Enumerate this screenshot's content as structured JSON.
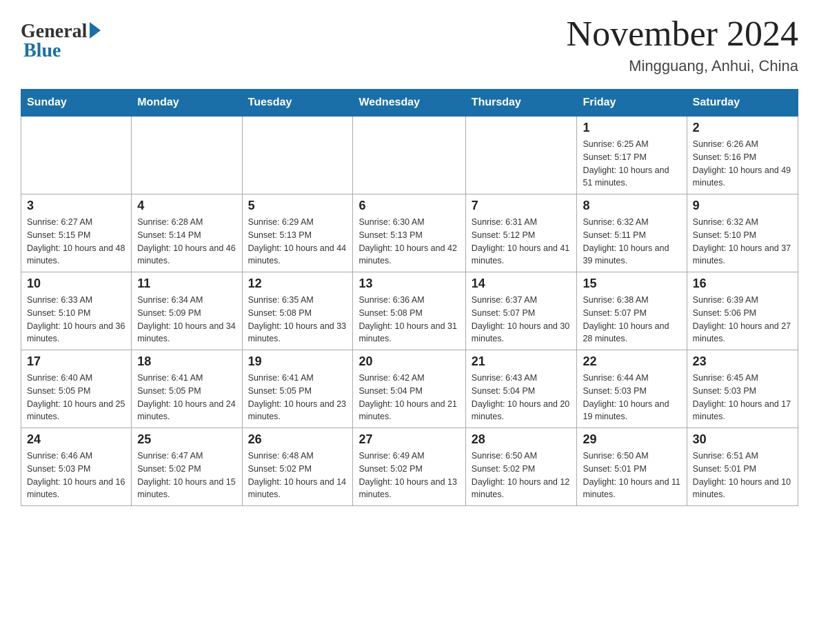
{
  "logo": {
    "general": "General",
    "blue": "Blue"
  },
  "header": {
    "month_year": "November 2024",
    "location": "Mingguang, Anhui, China"
  },
  "days_of_week": [
    "Sunday",
    "Monday",
    "Tuesday",
    "Wednesday",
    "Thursday",
    "Friday",
    "Saturday"
  ],
  "weeks": [
    [
      {
        "day": "",
        "info": ""
      },
      {
        "day": "",
        "info": ""
      },
      {
        "day": "",
        "info": ""
      },
      {
        "day": "",
        "info": ""
      },
      {
        "day": "",
        "info": ""
      },
      {
        "day": "1",
        "info": "Sunrise: 6:25 AM\nSunset: 5:17 PM\nDaylight: 10 hours and 51 minutes."
      },
      {
        "day": "2",
        "info": "Sunrise: 6:26 AM\nSunset: 5:16 PM\nDaylight: 10 hours and 49 minutes."
      }
    ],
    [
      {
        "day": "3",
        "info": "Sunrise: 6:27 AM\nSunset: 5:15 PM\nDaylight: 10 hours and 48 minutes."
      },
      {
        "day": "4",
        "info": "Sunrise: 6:28 AM\nSunset: 5:14 PM\nDaylight: 10 hours and 46 minutes."
      },
      {
        "day": "5",
        "info": "Sunrise: 6:29 AM\nSunset: 5:13 PM\nDaylight: 10 hours and 44 minutes."
      },
      {
        "day": "6",
        "info": "Sunrise: 6:30 AM\nSunset: 5:13 PM\nDaylight: 10 hours and 42 minutes."
      },
      {
        "day": "7",
        "info": "Sunrise: 6:31 AM\nSunset: 5:12 PM\nDaylight: 10 hours and 41 minutes."
      },
      {
        "day": "8",
        "info": "Sunrise: 6:32 AM\nSunset: 5:11 PM\nDaylight: 10 hours and 39 minutes."
      },
      {
        "day": "9",
        "info": "Sunrise: 6:32 AM\nSunset: 5:10 PM\nDaylight: 10 hours and 37 minutes."
      }
    ],
    [
      {
        "day": "10",
        "info": "Sunrise: 6:33 AM\nSunset: 5:10 PM\nDaylight: 10 hours and 36 minutes."
      },
      {
        "day": "11",
        "info": "Sunrise: 6:34 AM\nSunset: 5:09 PM\nDaylight: 10 hours and 34 minutes."
      },
      {
        "day": "12",
        "info": "Sunrise: 6:35 AM\nSunset: 5:08 PM\nDaylight: 10 hours and 33 minutes."
      },
      {
        "day": "13",
        "info": "Sunrise: 6:36 AM\nSunset: 5:08 PM\nDaylight: 10 hours and 31 minutes."
      },
      {
        "day": "14",
        "info": "Sunrise: 6:37 AM\nSunset: 5:07 PM\nDaylight: 10 hours and 30 minutes."
      },
      {
        "day": "15",
        "info": "Sunrise: 6:38 AM\nSunset: 5:07 PM\nDaylight: 10 hours and 28 minutes."
      },
      {
        "day": "16",
        "info": "Sunrise: 6:39 AM\nSunset: 5:06 PM\nDaylight: 10 hours and 27 minutes."
      }
    ],
    [
      {
        "day": "17",
        "info": "Sunrise: 6:40 AM\nSunset: 5:05 PM\nDaylight: 10 hours and 25 minutes."
      },
      {
        "day": "18",
        "info": "Sunrise: 6:41 AM\nSunset: 5:05 PM\nDaylight: 10 hours and 24 minutes."
      },
      {
        "day": "19",
        "info": "Sunrise: 6:41 AM\nSunset: 5:05 PM\nDaylight: 10 hours and 23 minutes."
      },
      {
        "day": "20",
        "info": "Sunrise: 6:42 AM\nSunset: 5:04 PM\nDaylight: 10 hours and 21 minutes."
      },
      {
        "day": "21",
        "info": "Sunrise: 6:43 AM\nSunset: 5:04 PM\nDaylight: 10 hours and 20 minutes."
      },
      {
        "day": "22",
        "info": "Sunrise: 6:44 AM\nSunset: 5:03 PM\nDaylight: 10 hours and 19 minutes."
      },
      {
        "day": "23",
        "info": "Sunrise: 6:45 AM\nSunset: 5:03 PM\nDaylight: 10 hours and 17 minutes."
      }
    ],
    [
      {
        "day": "24",
        "info": "Sunrise: 6:46 AM\nSunset: 5:03 PM\nDaylight: 10 hours and 16 minutes."
      },
      {
        "day": "25",
        "info": "Sunrise: 6:47 AM\nSunset: 5:02 PM\nDaylight: 10 hours and 15 minutes."
      },
      {
        "day": "26",
        "info": "Sunrise: 6:48 AM\nSunset: 5:02 PM\nDaylight: 10 hours and 14 minutes."
      },
      {
        "day": "27",
        "info": "Sunrise: 6:49 AM\nSunset: 5:02 PM\nDaylight: 10 hours and 13 minutes."
      },
      {
        "day": "28",
        "info": "Sunrise: 6:50 AM\nSunset: 5:02 PM\nDaylight: 10 hours and 12 minutes."
      },
      {
        "day": "29",
        "info": "Sunrise: 6:50 AM\nSunset: 5:01 PM\nDaylight: 10 hours and 11 minutes."
      },
      {
        "day": "30",
        "info": "Sunrise: 6:51 AM\nSunset: 5:01 PM\nDaylight: 10 hours and 10 minutes."
      }
    ]
  ]
}
